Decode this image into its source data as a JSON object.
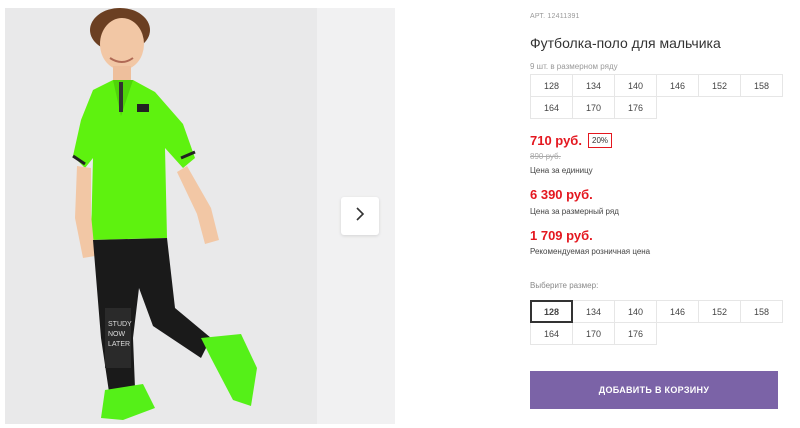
{
  "product": {
    "article": "АРТ. 12411391",
    "title": "Футболка-поло для мальчика",
    "image_alt": "Мальчик в зелёной футболке-поло и чёрных брюках"
  },
  "pack": {
    "note": "9 шт. в размерном ряду",
    "sizes": [
      "128",
      "134",
      "140",
      "146",
      "152",
      "158",
      "164",
      "170",
      "176"
    ]
  },
  "pricing": {
    "unit_price": "710 руб.",
    "discount_badge": "20%",
    "old_price": "890 руб.",
    "unit_caption": "Цена за единицу",
    "row_price": "6 390 руб.",
    "row_caption": "Цена за размерный ряд",
    "retail_price": "1 709 руб.",
    "retail_caption": "Рекомендуемая розничная цена"
  },
  "size_picker": {
    "label": "Выберите размер:",
    "selected": "128",
    "sizes": [
      "128",
      "134",
      "140",
      "146",
      "152",
      "158",
      "164",
      "170",
      "176"
    ]
  },
  "cart": {
    "add_label": "ДОБАВИТЬ В КОРЗИНУ"
  },
  "icons": {
    "next": "chevron-right-icon"
  },
  "colors": {
    "price_red": "#e4171f",
    "button_purple": "#7b63a7",
    "shirt_green": "#5ef20f"
  }
}
